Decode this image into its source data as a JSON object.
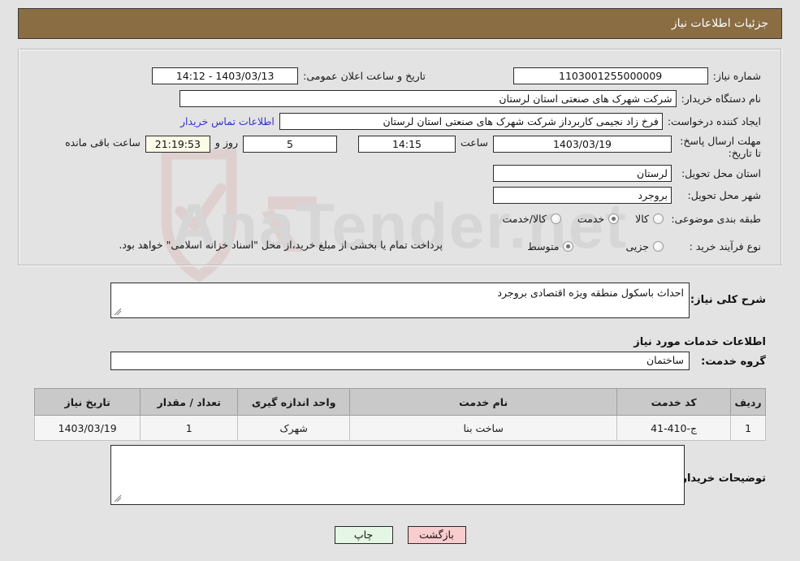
{
  "header": {
    "title": "جزئیات اطلاعات نیاز"
  },
  "colors": {
    "header_bg": "#8a6d43",
    "page_bg": "#e3e3e3",
    "link": "#3333cc",
    "countdown_bg": "#fbfbe8",
    "table_header_bg": "#c9c9c9",
    "print_button_bg": "#e4f6e4",
    "back_button_bg": "#f9ccce"
  },
  "form": {
    "need_number_label": "شماره نیاز:",
    "need_number_value": "1103001255000009",
    "announce_datetime_label": "تاریخ و ساعت اعلان عمومی:",
    "announce_datetime_value": "1403/03/13 - 14:12",
    "buyer_org_label": "نام دستگاه خریدار:",
    "buyer_org_value": "شرکت شهرک های صنعتی استان لرستان",
    "requester_label": "ایجاد کننده درخواست:",
    "requester_value": "فرخ زاد نجیمی کاربرداز شرکت شهرک های صنعتی استان لرستان",
    "buyer_contact_link": "اطلاعات تماس خریدار",
    "deadline_label": "مهلت ارسال پاسخ: تا تاریخ:",
    "deadline_date": "1403/03/19",
    "deadline_time_label": "ساعت",
    "deadline_time": "14:15",
    "remaining_days": "5",
    "remaining_days_label": "روز و",
    "remaining_clock": "21:19:53",
    "remaining_clock_label": "ساعت باقی مانده",
    "province_label": "استان محل تحویل:",
    "province_value": "لرستان",
    "city_label": "شهر محل تحویل:",
    "city_value": "بروجرد",
    "classification_label": "طبقه بندی موضوعی:",
    "classification_options": [
      {
        "label": "کالا",
        "selected": false
      },
      {
        "label": "خدمت",
        "selected": true
      },
      {
        "label": "کالا/خدمت",
        "selected": false
      }
    ],
    "process_type_label": "نوع فرآیند خرید :",
    "process_type_options": [
      {
        "label": "جزیی",
        "selected": false
      },
      {
        "label": "متوسط",
        "selected": true
      }
    ],
    "payment_note": "پرداخت تمام یا بخشی از مبلغ خرید،از محل \"اسناد خزانه اسلامی\" خواهد بود.",
    "general_desc_label": "شرح کلی نیاز:",
    "general_desc_value": "احداث باسکول منطقه ویژه اقتصادی بروجرد",
    "services_section_title": "اطلاعات خدمات مورد نیاز",
    "service_group_label": "گروه خدمت:",
    "service_group_value": "ساختمان",
    "buyer_notes_label": "توضیحات خریدار:",
    "buyer_notes_value": ""
  },
  "table": {
    "columns": [
      "ردیف",
      "کد خدمت",
      "نام خدمت",
      "واحد اندازه گیری",
      "تعداد / مقدار",
      "تاریخ نیاز"
    ],
    "rows": [
      {
        "row_no": "1",
        "service_code": "ج-410-41",
        "service_name": "ساخت بنا",
        "unit": "شهرک",
        "quantity": "1",
        "need_date": "1403/03/19"
      }
    ]
  },
  "footer": {
    "print_label": "چاپ",
    "back_label": "بازگشت"
  },
  "watermark": {
    "text": "AnaTender.net"
  }
}
